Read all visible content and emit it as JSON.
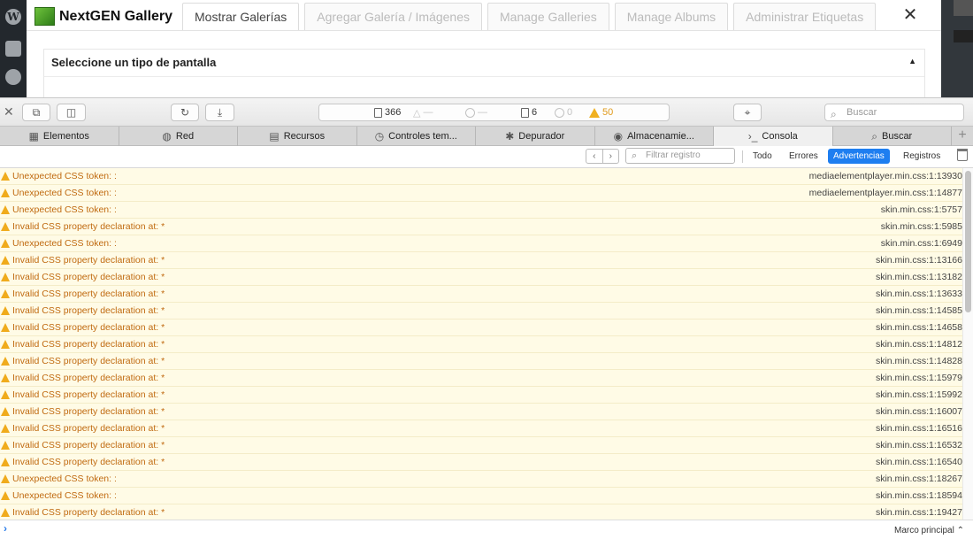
{
  "background_page": {
    "brand_name": "NextGEN Gallery",
    "tabs": [
      "Mostrar Galerías",
      "Agregar Galería / Imágenes",
      "Manage Galleries",
      "Manage Albums",
      "Administrar Etiquetas"
    ],
    "active_tab_index": 0,
    "close_glyph": "✕",
    "panel_title": "Seleccione un tipo de pantalla",
    "panel_caret": "▲"
  },
  "toolbar": {
    "resource_count": "366",
    "dash_1": "—",
    "dash_2": "—",
    "log_count": "6",
    "error_count": "0",
    "warning_count": "50",
    "search_placeholder": "Buscar"
  },
  "tabs": [
    {
      "label": "Elementos",
      "icon": "elements-icon"
    },
    {
      "label": "Red",
      "icon": "network-icon"
    },
    {
      "label": "Recursos",
      "icon": "resources-icon"
    },
    {
      "label": "Controles tem...",
      "icon": "timelines-icon"
    },
    {
      "label": "Depurador",
      "icon": "debugger-icon"
    },
    {
      "label": "Almacenamie...",
      "icon": "storage-icon"
    },
    {
      "label": "Consola",
      "icon": "console-icon"
    },
    {
      "label": "Buscar",
      "icon": "search-icon"
    }
  ],
  "active_tab": "Consola",
  "filter": {
    "placeholder": "Filtrar registro",
    "buttons": [
      "Todo",
      "Errores",
      "Advertencias",
      "Registros"
    ],
    "active": "Advertencias",
    "accent_color": "#1e7ef0"
  },
  "log_rows": [
    {
      "msg": "Unexpected CSS token: :",
      "src": "mediaelementplayer.min.css:1:13930"
    },
    {
      "msg": "Unexpected CSS token: :",
      "src": "mediaelementplayer.min.css:1:14877"
    },
    {
      "msg": "Unexpected CSS token: :",
      "src": "skin.min.css:1:5757"
    },
    {
      "msg": "Invalid CSS property declaration at: *",
      "src": "skin.min.css:1:5985"
    },
    {
      "msg": "Unexpected CSS token: :",
      "src": "skin.min.css:1:6949"
    },
    {
      "msg": "Invalid CSS property declaration at: *",
      "src": "skin.min.css:1:13166"
    },
    {
      "msg": "Invalid CSS property declaration at: *",
      "src": "skin.min.css:1:13182"
    },
    {
      "msg": "Invalid CSS property declaration at: *",
      "src": "skin.min.css:1:13633"
    },
    {
      "msg": "Invalid CSS property declaration at: *",
      "src": "skin.min.css:1:14585"
    },
    {
      "msg": "Invalid CSS property declaration at: *",
      "src": "skin.min.css:1:14658"
    },
    {
      "msg": "Invalid CSS property declaration at: *",
      "src": "skin.min.css:1:14812"
    },
    {
      "msg": "Invalid CSS property declaration at: *",
      "src": "skin.min.css:1:14828"
    },
    {
      "msg": "Invalid CSS property declaration at: *",
      "src": "skin.min.css:1:15979"
    },
    {
      "msg": "Invalid CSS property declaration at: *",
      "src": "skin.min.css:1:15992"
    },
    {
      "msg": "Invalid CSS property declaration at: *",
      "src": "skin.min.css:1:16007"
    },
    {
      "msg": "Invalid CSS property declaration at: *",
      "src": "skin.min.css:1:16516"
    },
    {
      "msg": "Invalid CSS property declaration at: *",
      "src": "skin.min.css:1:16532"
    },
    {
      "msg": "Invalid CSS property declaration at: *",
      "src": "skin.min.css:1:16540"
    },
    {
      "msg": "Unexpected CSS token: :",
      "src": "skin.min.css:1:18267"
    },
    {
      "msg": "Unexpected CSS token: :",
      "src": "skin.min.css:1:18594"
    },
    {
      "msg": "Invalid CSS property declaration at: *",
      "src": "skin.min.css:1:19427"
    }
  ],
  "prompt": {
    "chevron": "›",
    "frame_label": "Marco principal ⌃"
  },
  "colors": {
    "warning_row_bg": "#fffbe6",
    "warning_text": "#c06a10",
    "warning_icon": "#f0ab1c"
  }
}
